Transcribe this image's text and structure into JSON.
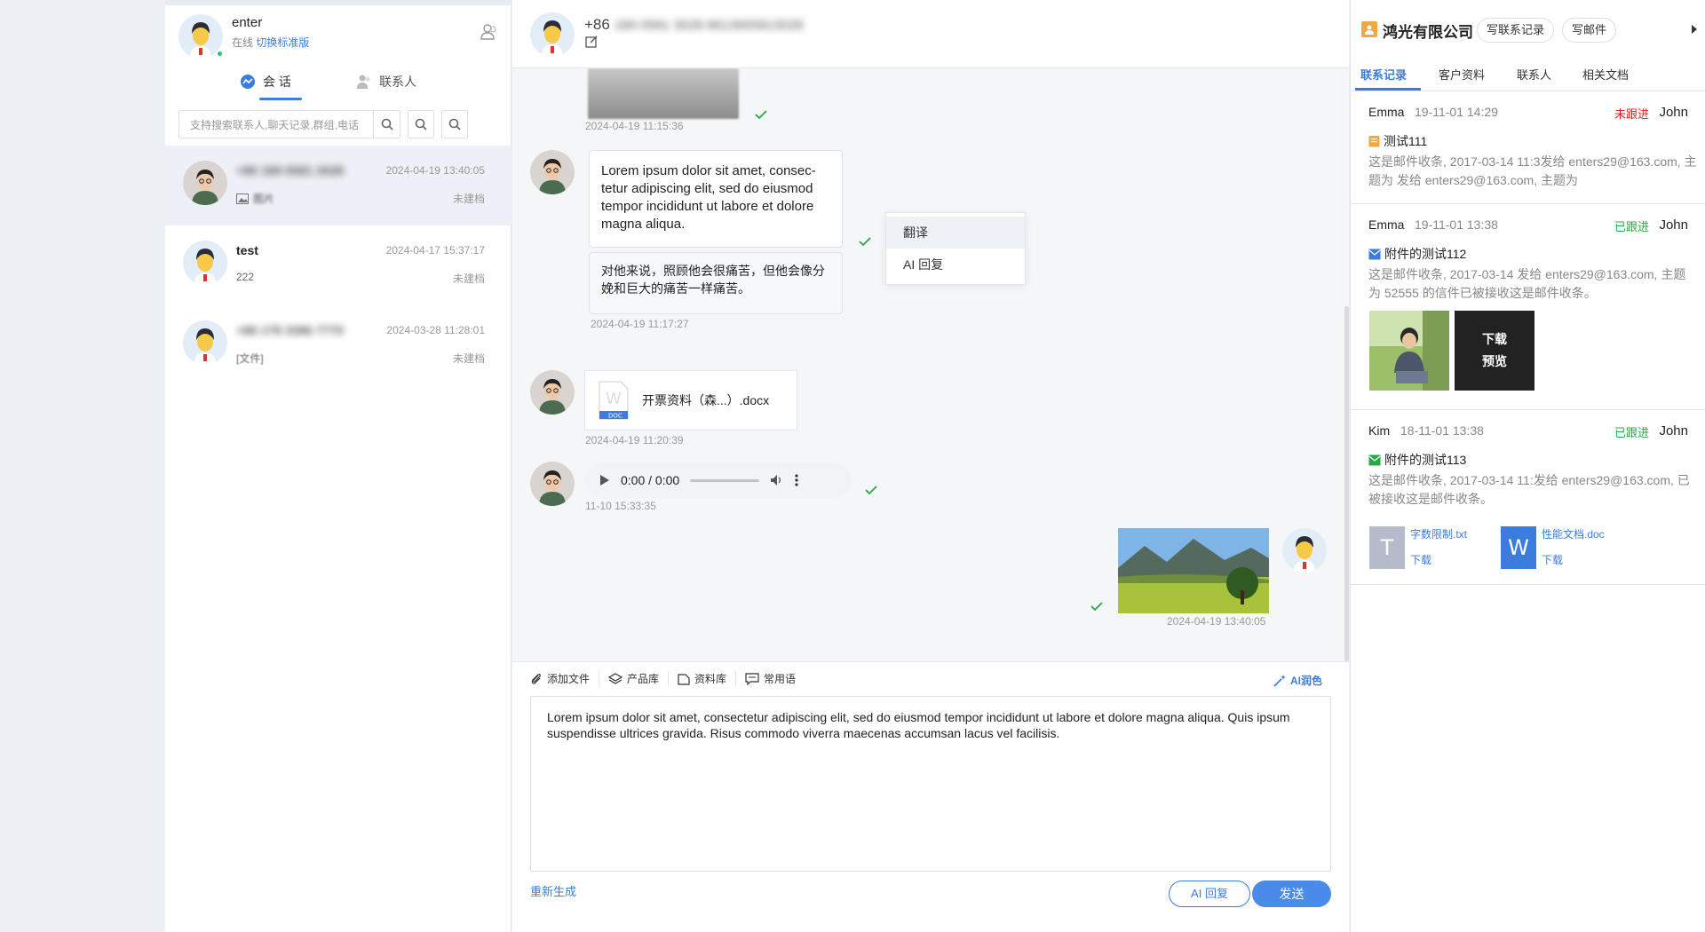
{
  "user": {
    "name": "enter",
    "status": "在线",
    "switch_label": "切换标准版"
  },
  "tabs": {
    "sessions": "会 话",
    "contacts": "联系人"
  },
  "search": {
    "placeholder": "支持搜索联系人,聊天记录,群组,电话"
  },
  "conversations": [
    {
      "name": "+86 189 0581 3028",
      "time": "2024-04-19 13:40:05",
      "message": "图片",
      "tag": "未建档"
    },
    {
      "name": "test",
      "time": "2024-04-17 15:37:17",
      "message": "222",
      "tag": "未建档"
    },
    {
      "name": "+86 178 3386 7770",
      "time": "2024-03-28 11:28:01",
      "message": "[文件]",
      "tag": "未建档"
    }
  ],
  "chat": {
    "phone_prefix": "+86",
    "phone_blurred": "189 0581 3028  8613905813028",
    "messages": {
      "ts1": "2024-04-19 11:15:36",
      "text_msg": "Lorem ipsum dolor sit amet, consec-tetur adipiscing elit, sed do eiusmod tempor incididunt ut labore et dolore magna aliqua.",
      "translation": "对他来说，照顾他会很痛苦，但他会像分娩和巨大的痛苦一样痛苦。",
      "ts2": "2024-04-19 11:17:27",
      "file_name": "开票资料（森...）.docx",
      "ts3": "2024-04-19 11:20:39",
      "audio_time": "0:00 / 0:00",
      "ts4": "11-10 15:33:35",
      "ts5": "2024-04-19 13:40:05"
    },
    "context_menu": [
      "翻译",
      "AI 回复"
    ]
  },
  "composer": {
    "tools": [
      "添加文件",
      "产品库",
      "资料库",
      "常用语"
    ],
    "ai_polish": "AI润色",
    "text": "Lorem ipsum dolor sit amet, consectetur adipiscing elit, sed do eiusmod tempor incididunt ut labore et dolore magna aliqua. Quis ipsum suspendisse ultrices gravida. Risus commodo viverra maecenas accumsan lacus vel facilisis.",
    "regenerate": "重新生成",
    "ai_reply": "AI 回复",
    "send": "发送"
  },
  "right_panel": {
    "company": "鸿光有限公司",
    "btn_record": "写联系记录",
    "btn_mail": "写邮件",
    "tabs": [
      "联系记录",
      "客户资料",
      "联系人",
      "相关文档"
    ],
    "records": [
      {
        "name": "Emma",
        "time": "19-11-01 14:29",
        "status": "未跟进",
        "owner": "John",
        "title": "测试111",
        "body": "这是邮件收条, 2017-03-14 11:3发给 enters29@163.com, 主题为  发给 enters29@163.com, 主题为"
      },
      {
        "name": "Emma",
        "time": "19-11-01 13:38",
        "status": "已跟进",
        "owner": "John",
        "title": "附件的测试112",
        "body": "这是邮件收条, 2017-03-14 发给 enters29@163.com, 主题为 52555 的信件已被接收这是邮件收条。",
        "overlay_download": "下载",
        "overlay_preview": "预览"
      },
      {
        "name": "Kim",
        "time": "18-11-01 13:38",
        "status": "已跟进",
        "owner": "John",
        "title": "附件的测试113",
        "body": "这是邮件收条, 2017-03-14 11:发给 enters29@163.com, 已被接收这是邮件收条。",
        "att1_name": "字数限制.txt",
        "att1_dl": "下载",
        "att2_name": "性能文档.doc",
        "att2_dl": "下载"
      }
    ]
  },
  "colors": {
    "accent": "#3b7ddd",
    "red": "#e02020",
    "green": "#27a844"
  }
}
